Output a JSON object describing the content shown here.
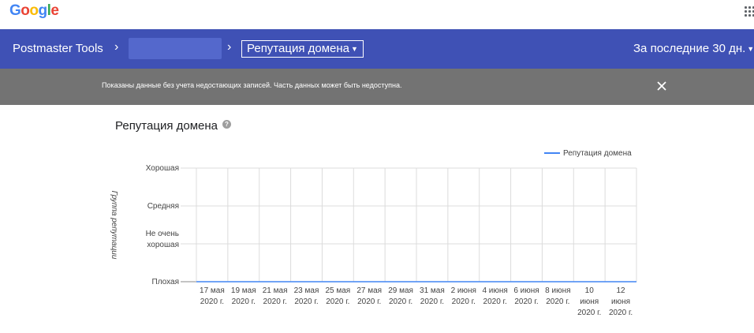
{
  "header": {
    "logo": "Google"
  },
  "nav": {
    "title": "Postmaster Tools",
    "separator": ">",
    "dropdown_label": "Репутация домена",
    "period_label": "За последние 30 дн."
  },
  "banner": {
    "message": "Показаны данные без учета недостающих записей. Часть данных может быть недоступна."
  },
  "section": {
    "title": "Репутация домена"
  },
  "chart_data": {
    "type": "line",
    "ylabel": "Группа репутации",
    "y_categories": [
      "Плохая",
      "Не очень хорошая",
      "Средняя",
      "Хорошая"
    ],
    "x": [
      [
        "17 мая",
        "2020 г."
      ],
      [
        "19 мая",
        "2020 г."
      ],
      [
        "21 мая",
        "2020 г."
      ],
      [
        "23 мая",
        "2020 г."
      ],
      [
        "25 мая",
        "2020 г."
      ],
      [
        "27 мая",
        "2020 г."
      ],
      [
        "29 мая",
        "2020 г."
      ],
      [
        "31 мая",
        "2020 г."
      ],
      [
        "2 июня",
        "2020 г."
      ],
      [
        "4 июня",
        "2020 г."
      ],
      [
        "6 июня",
        "2020 г."
      ],
      [
        "8 июня",
        "2020 г."
      ],
      [
        "10",
        "июня",
        "2020 г."
      ],
      [
        "12",
        "июня",
        "2020 г."
      ]
    ],
    "series": [
      {
        "name": "Репутация домена",
        "values": [],
        "color": "#4285f4"
      }
    ],
    "legend": "top-right",
    "grid": true
  }
}
